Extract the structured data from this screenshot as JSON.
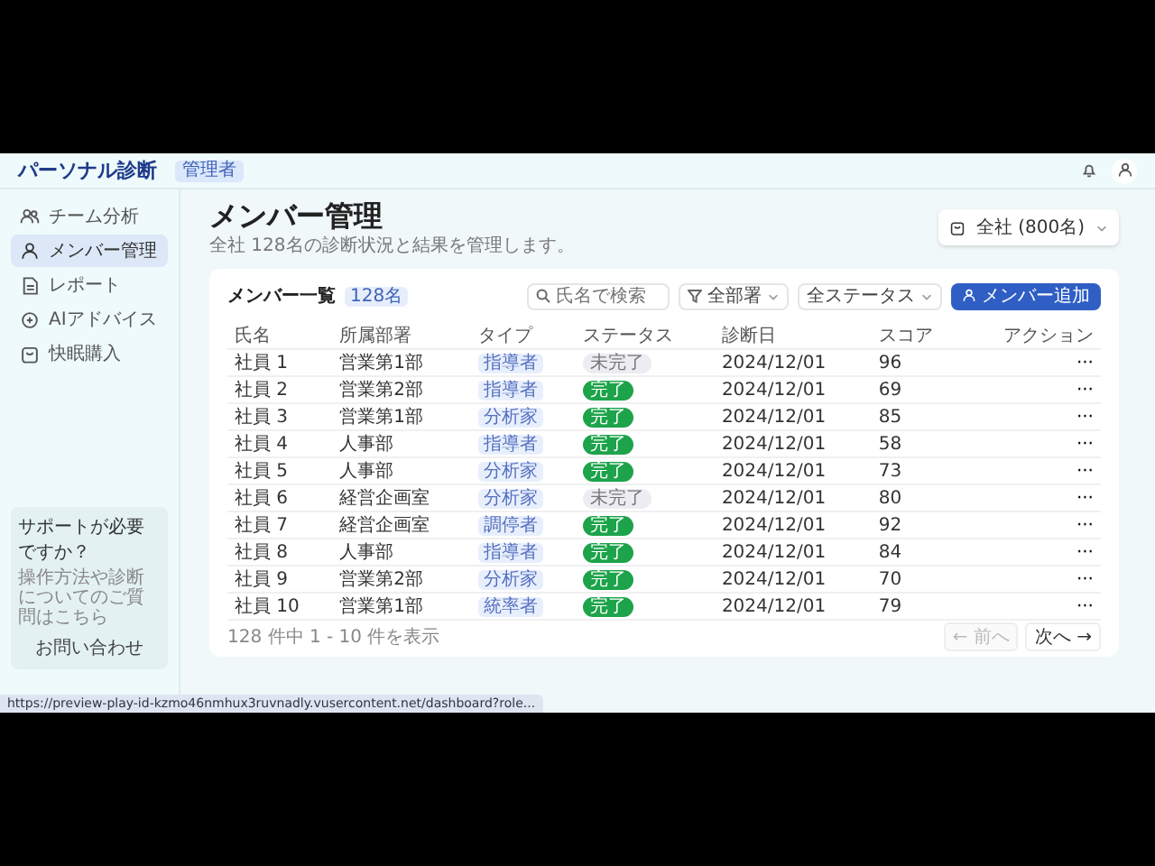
{
  "header": {
    "app_title": "パーソナル診断",
    "role_badge": "管理者"
  },
  "sidebar": {
    "items": [
      {
        "label": "チーム分析",
        "selected": false
      },
      {
        "label": "メンバー管理",
        "selected": true
      },
      {
        "label": "レポート",
        "selected": false
      },
      {
        "label": "AIアドバイス",
        "selected": false
      },
      {
        "label": "快眠購入",
        "selected": false
      }
    ],
    "support": {
      "title": "サポートが必要ですか？",
      "text": "操作方法や診断についてのご質問はこちら",
      "button": "お問い合わせ"
    }
  },
  "page": {
    "title": "メンバー管理",
    "subtitle": "全社 128名の診断状況と結果を管理します。",
    "scope_select": "全社 (800名)"
  },
  "card": {
    "title": "メンバー一覧",
    "count_badge": "128名",
    "search": {
      "placeholder": "氏名で検索"
    },
    "department_filter": "全部署",
    "status_filter": "全ステータス",
    "add_button": "メンバー追加"
  },
  "table": {
    "columns": [
      "氏名",
      "所属部署",
      "タイプ",
      "ステータス",
      "診断日",
      "スコア",
      "アクション"
    ],
    "rows": [
      {
        "name": "社員 1",
        "department": "営業第1部",
        "type": "指導者",
        "status": "未完了",
        "done": false,
        "date": "2024/12/01",
        "score": "96",
        "action": "···"
      },
      {
        "name": "社員 2",
        "department": "営業第2部",
        "type": "指導者",
        "status": "完了",
        "done": true,
        "date": "2024/12/01",
        "score": "69",
        "action": "···"
      },
      {
        "name": "社員 3",
        "department": "営業第1部",
        "type": "分析家",
        "status": "完了",
        "done": true,
        "date": "2024/12/01",
        "score": "85",
        "action": "···"
      },
      {
        "name": "社員 4",
        "department": "人事部",
        "type": "指導者",
        "status": "完了",
        "done": true,
        "date": "2024/12/01",
        "score": "58",
        "action": "···"
      },
      {
        "name": "社員 5",
        "department": "人事部",
        "type": "分析家",
        "status": "完了",
        "done": true,
        "date": "2024/12/01",
        "score": "73",
        "action": "···"
      },
      {
        "name": "社員 6",
        "department": "経営企画室",
        "type": "分析家",
        "status": "未完了",
        "done": false,
        "date": "2024/12/01",
        "score": "80",
        "action": "···"
      },
      {
        "name": "社員 7",
        "department": "経営企画室",
        "type": "調停者",
        "status": "完了",
        "done": true,
        "date": "2024/12/01",
        "score": "92",
        "action": "···"
      },
      {
        "name": "社員 8",
        "department": "人事部",
        "type": "指導者",
        "status": "完了",
        "done": true,
        "date": "2024/12/01",
        "score": "84",
        "action": "···"
      },
      {
        "name": "社員 9",
        "department": "営業第2部",
        "type": "分析家",
        "status": "完了",
        "done": true,
        "date": "2024/12/01",
        "score": "70",
        "action": "···"
      },
      {
        "name": "社員 10",
        "department": "営業第1部",
        "type": "統率者",
        "status": "完了",
        "done": true,
        "date": "2024/12/01",
        "score": "79",
        "action": "···"
      }
    ]
  },
  "pagination": {
    "summary": "128 件中 1 - 10 件を表示",
    "prev": {
      "label": "← 前へ",
      "disabled": true
    },
    "next": {
      "label": "次へ →",
      "disabled": false
    }
  },
  "status_bar": {
    "url": "https://preview-play-id-kzmo46nmhux3ruvnadly.vusercontent.net/dashboard?role..."
  }
}
